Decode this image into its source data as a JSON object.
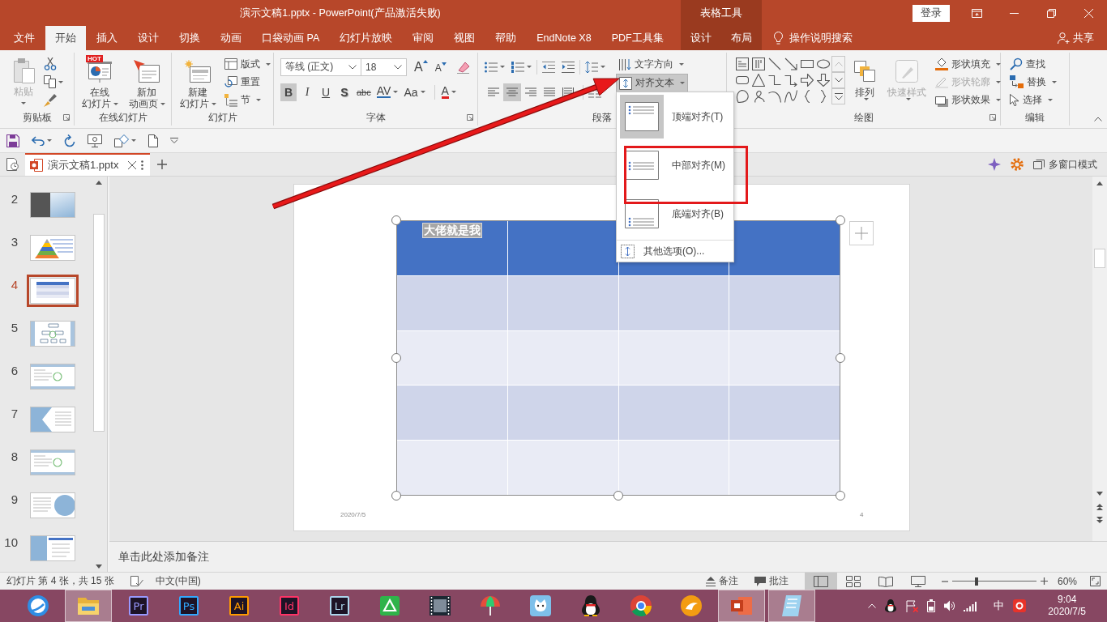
{
  "window": {
    "title": "演示文稿1.pptx - PowerPoint(产品激活失败)",
    "tool_group": "表格工具",
    "sign_in": "登录"
  },
  "tabs": [
    {
      "label": "文件",
      "selected": false,
      "contextual": false
    },
    {
      "label": "开始",
      "selected": true,
      "contextual": false
    },
    {
      "label": "插入",
      "selected": false,
      "contextual": false
    },
    {
      "label": "设计",
      "selected": false,
      "contextual": false
    },
    {
      "label": "切换",
      "selected": false,
      "contextual": false
    },
    {
      "label": "动画",
      "selected": false,
      "contextual": false
    },
    {
      "label": "口袋动画 PA",
      "selected": false,
      "contextual": false
    },
    {
      "label": "幻灯片放映",
      "selected": false,
      "contextual": false
    },
    {
      "label": "审阅",
      "selected": false,
      "contextual": false
    },
    {
      "label": "视图",
      "selected": false,
      "contextual": false
    },
    {
      "label": "帮助",
      "selected": false,
      "contextual": false
    },
    {
      "label": "EndNote X8",
      "selected": false,
      "contextual": false
    },
    {
      "label": "PDF工具集",
      "selected": false,
      "contextual": false
    },
    {
      "label": "设计",
      "selected": false,
      "contextual": true
    },
    {
      "label": "布局",
      "selected": false,
      "contextual": true
    }
  ],
  "tell_me": {
    "placeholder": "操作说明搜索"
  },
  "share": "共享",
  "ribbon": {
    "groups": [
      {
        "kind": "clipboard",
        "label": "剪贴板",
        "paste": {
          "label": "粘贴",
          "disabled": true
        }
      },
      {
        "kind": "online",
        "label": "在线幻灯片",
        "buttons": [
          {
            "kind": "online",
            "lines": [
              "在线",
              "幻灯片"
            ],
            "badge": "HOT"
          },
          {
            "kind": "animation",
            "lines": [
              "新加",
              "动画页"
            ]
          }
        ]
      },
      {
        "kind": "slides",
        "label": "幻灯片",
        "new_slide": [
          "新建",
          "幻灯片"
        ],
        "buttons": [
          {
            "kind": "layout",
            "label": "版式",
            "menu": true
          },
          {
            "kind": "reset",
            "label": "重置",
            "menu": false
          },
          {
            "kind": "section",
            "label": "节",
            "menu": true
          }
        ]
      },
      {
        "kind": "font",
        "label": "字体",
        "font": "等线 (正文)",
        "size": "18",
        "size_buttons": [
          {
            "kind": "grow",
            "glyph": "A"
          },
          {
            "kind": "shrink",
            "glyph": "A"
          }
        ],
        "format": [
          {
            "kind": "bold",
            "glyph": "B",
            "selected": true,
            "menu": false
          },
          {
            "kind": "italic",
            "glyph": "I",
            "selected": false,
            "menu": false
          },
          {
            "kind": "underline",
            "glyph": "U",
            "selected": false,
            "menu": false
          },
          {
            "kind": "shadow",
            "glyph": "S",
            "selected": false,
            "menu": false
          },
          {
            "kind": "strike",
            "glyph": "abc",
            "selected": false,
            "menu": false
          },
          {
            "kind": "spacing",
            "glyph": "AV",
            "selected": false,
            "menu": true
          },
          {
            "kind": "case",
            "glyph": "Aa",
            "selected": false,
            "menu": true
          },
          {
            "kind": "color",
            "glyph": "A",
            "selected": false,
            "menu": true
          }
        ]
      },
      {
        "kind": "paragraph",
        "label": "段落",
        "alignment": [
          {
            "kind": "left",
            "selected": false
          },
          {
            "kind": "center",
            "selected": true
          },
          {
            "kind": "right",
            "selected": false
          },
          {
            "kind": "justify",
            "selected": false
          },
          {
            "kind": "distributed",
            "selected": false
          }
        ],
        "text_direction": "文字方向",
        "align_text": {
          "label": "对齐文本",
          "selected": true
        }
      },
      {
        "kind": "drawing",
        "label": "绘图",
        "arrange": "排列",
        "quick_styles": {
          "label": "快速样式",
          "disabled": true
        },
        "buttons": [
          {
            "kind": "fill",
            "label": "形状填充",
            "disabled": false
          },
          {
            "kind": "outline",
            "label": "形状轮廓",
            "disabled": true
          },
          {
            "kind": "effects",
            "label": "形状效果",
            "disabled": false
          }
        ]
      },
      {
        "kind": "editing",
        "label": "编辑",
        "buttons": [
          {
            "kind": "find",
            "label": "查找",
            "menu": false
          },
          {
            "kind": "replace",
            "label": "替换",
            "menu": true
          },
          {
            "kind": "select",
            "label": "选择",
            "menu": true
          }
        ]
      }
    ]
  },
  "document_tabs": [
    {
      "label": "演示文稿1.pptx",
      "selected": true
    }
  ],
  "multi_window": "多窗口模式",
  "slides": [
    {
      "number": "2",
      "kind": "title-photo",
      "selected": false
    },
    {
      "number": "3",
      "kind": "pyramid",
      "selected": false
    },
    {
      "number": "4",
      "kind": "table",
      "selected": true
    },
    {
      "number": "5",
      "kind": "diagram",
      "selected": false
    },
    {
      "number": "6",
      "kind": "figure-text",
      "selected": false
    },
    {
      "number": "7",
      "kind": "photo-text",
      "selected": false
    },
    {
      "number": "8",
      "kind": "figure-text",
      "selected": false
    },
    {
      "number": "9",
      "kind": "circle-photo",
      "selected": false
    },
    {
      "number": "10",
      "kind": "photo-list",
      "selected": false
    }
  ],
  "slide": {
    "table": {
      "selected": true,
      "rows": [
        {
          "kind": "header",
          "cells": [
            {
              "text": "大佬就是我",
              "selected": true
            },
            null,
            null,
            null
          ]
        },
        {
          "kind": "band",
          "cells": [
            null,
            null,
            null,
            null
          ]
        },
        {
          "kind": "plain",
          "cells": [
            null,
            null,
            null,
            null
          ]
        },
        {
          "kind": "band",
          "cells": [
            null,
            null,
            null,
            null
          ]
        },
        {
          "kind": "plain",
          "cells": [
            null,
            null,
            null,
            null
          ]
        }
      ]
    },
    "date": "2020/7/5",
    "page_number": "4"
  },
  "align_menu": [
    {
      "kind": "top",
      "label": "顶端对齐(T)",
      "selected": true
    },
    {
      "kind": "middle",
      "label": "中部对齐(M)",
      "selected": false
    },
    {
      "kind": "bottom",
      "label": "底端对齐(B)",
      "selected": false
    },
    {
      "kind": "more",
      "label": "其他选项(O)...",
      "selected": false
    }
  ],
  "notes": {
    "placeholder": "单击此处添加备注"
  },
  "status_bar": {
    "slide_info": "幻灯片 第 4 张，共 15 张",
    "language": "中文(中国)",
    "notes": "备注",
    "comments": "批注",
    "views": [
      {
        "kind": "normal",
        "selected": true
      },
      {
        "kind": "sorter",
        "selected": false
      },
      {
        "kind": "reading",
        "selected": false
      },
      {
        "kind": "slideshow",
        "selected": false
      }
    ],
    "zoom": {
      "level": 0.29,
      "reading": "60%"
    }
  },
  "taskbar": {
    "apps": [
      {
        "kind": "browser",
        "active": false
      },
      {
        "kind": "folder",
        "active": true
      },
      {
        "kind": "letter",
        "label": "Pr",
        "color": "#9999ff",
        "active": false
      },
      {
        "kind": "letter",
        "label": "Ps",
        "color": "#31a8ff",
        "active": false
      },
      {
        "kind": "letter",
        "label": "Ai",
        "color": "#ff9a00",
        "active": false
      },
      {
        "kind": "letter",
        "label": "Id",
        "color": "#ff3366",
        "active": false
      },
      {
        "kind": "letter",
        "label": "Lr",
        "color": "#add5ec",
        "active": false
      },
      {
        "kind": "triangle",
        "active": false
      },
      {
        "kind": "film",
        "active": false
      },
      {
        "kind": "umbrella",
        "active": false
      },
      {
        "kind": "cat",
        "active": false
      },
      {
        "kind": "penguin",
        "active": false
      },
      {
        "kind": "round",
        "active": false
      },
      {
        "kind": "bird",
        "active": false
      },
      {
        "kind": "slides",
        "active": true
      },
      {
        "kind": "notepad",
        "active": true
      }
    ],
    "tray": {
      "ime": "中",
      "time": "9:04",
      "date": "2020/7/5"
    }
  }
}
